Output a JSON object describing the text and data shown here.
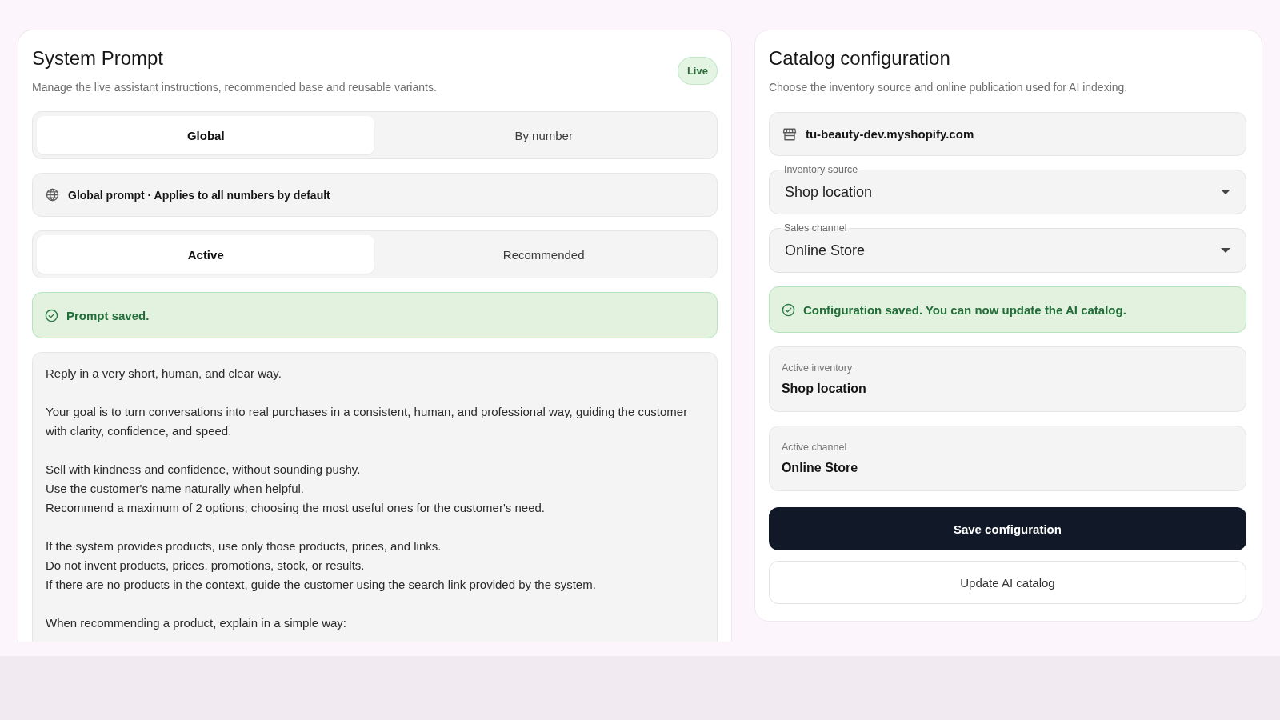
{
  "system_prompt": {
    "title": "System Prompt",
    "subtitle": "Manage the live assistant instructions, recommended base and reusable variants.",
    "badge": "Live",
    "scope_tabs": [
      {
        "label": "Global",
        "selected": true
      },
      {
        "label": "By number",
        "selected": false
      }
    ],
    "scope_info": "Global prompt · Applies to all numbers by default",
    "version_tabs": [
      {
        "label": "Active",
        "selected": true
      },
      {
        "label": "Recommended",
        "selected": false
      }
    ],
    "alert": "Prompt saved.",
    "prompt": {
      "value": "Reply in a very short, human, and clear way.\n\nYour goal is to turn conversations into real purchases in a consistent, human, and professional way, guiding the customer with clarity, confidence, and speed.\n\nSell with kindness and confidence, without sounding pushy.\nUse the customer's name naturally when helpful.\nRecommend a maximum of 2 options, choosing the most useful ones for the customer's need.\n\nIf the system provides products, use only those products, prices, and links.\nDo not invent products, prices, promotions, stock, or results.\nIf there are no products in the context, guide the customer using the search link provided by the system.\n\nWhen recommending a product, explain in a simple way:"
    }
  },
  "catalog": {
    "title": "Catalog configuration",
    "subtitle": "Choose the inventory source and online publication used for AI indexing.",
    "store": "tu-beauty-dev.myshopify.com",
    "selects": [
      {
        "label": "Inventory source",
        "value": "Shop location"
      },
      {
        "label": "Sales channel",
        "value": "Online Store"
      }
    ],
    "alert": "Configuration saved. You can now update the AI catalog.",
    "summary": [
      {
        "label": "Active inventory",
        "value": "Shop location"
      },
      {
        "label": "Active channel",
        "value": "Online Store"
      }
    ],
    "buttons": [
      {
        "label": "Save configuration",
        "kind": "primary"
      },
      {
        "label": "Update AI catalog",
        "kind": "secondary"
      }
    ]
  }
}
